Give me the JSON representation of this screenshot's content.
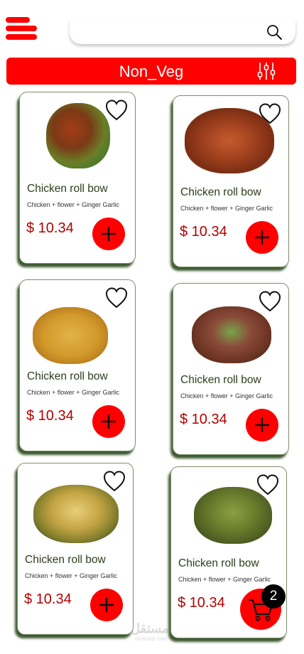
{
  "header": {
    "menu_icon": "hamburger-menu-icon",
    "search": {
      "value": "",
      "placeholder": "",
      "icon": "search-icon"
    }
  },
  "category": {
    "title": "Non_Veg",
    "filter_icon": "sliders-filter-icon"
  },
  "products": [
    {
      "name": "Chicken roll bow",
      "description": "Chicken + flower + Ginger Garlic",
      "price": "$ 10.34"
    },
    {
      "name": "Chicken roll bow",
      "description": "Chicken + flower + Ginger Garlic",
      "price": "$ 10.34"
    },
    {
      "name": "Chicken roll bow",
      "description": "Chicken + flower + Ginger Garlic",
      "price": "$ 10.34"
    },
    {
      "name": "Chicken roll bow",
      "description": "Chicken + flower + Ginger Garlic",
      "price": "$ 10.34"
    },
    {
      "name": "Chicken roll bow",
      "description": "Chicken + flower + Ginger Garlic",
      "price": "$ 10.34"
    },
    {
      "name": "Chicken roll bow",
      "description": "Chicken + flower + Ginger Garlic",
      "price": "$ 10.34"
    }
  ],
  "cart": {
    "count": "2",
    "icon": "shopping-cart-icon"
  },
  "watermark": {
    "text": "مستقل",
    "subtext": "mostaql.com"
  },
  "colors": {
    "accent": "#ff0000",
    "price": "#b30000",
    "card_shadow": "#3c5a30"
  }
}
